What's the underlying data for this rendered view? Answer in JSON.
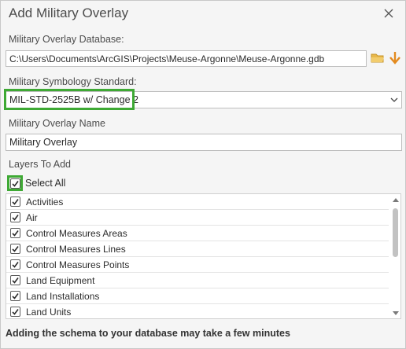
{
  "dialog": {
    "title": "Add Military Overlay"
  },
  "database": {
    "label": "Military Overlay Database:",
    "path": "C:\\Users\\Documents\\ArcGIS\\Projects\\Meuse-Argonne\\Meuse-Argonne.gdb"
  },
  "symbology": {
    "label": "Military Symbology Standard:",
    "selected": "MIL-STD-2525B w/ Change 2"
  },
  "overlay_name": {
    "label": "Military Overlay Name",
    "value": "Military Overlay"
  },
  "layers": {
    "label": "Layers To Add",
    "select_all_label": "Select All",
    "select_all_checked": true,
    "items": [
      {
        "label": "Activities",
        "checked": true
      },
      {
        "label": "Air",
        "checked": true
      },
      {
        "label": "Control Measures Areas",
        "checked": true
      },
      {
        "label": "Control Measures Lines",
        "checked": true
      },
      {
        "label": "Control Measures Points",
        "checked": true
      },
      {
        "label": "Land Equipment",
        "checked": true
      },
      {
        "label": "Land Installations",
        "checked": true
      },
      {
        "label": "Land Units",
        "checked": true
      }
    ]
  },
  "footer": {
    "note": "Adding the schema to your database may take a few minutes"
  },
  "colors": {
    "highlight": "#3ea934",
    "folder_icon": "#e8b84a",
    "arrow_icon": "#e38a1e"
  }
}
